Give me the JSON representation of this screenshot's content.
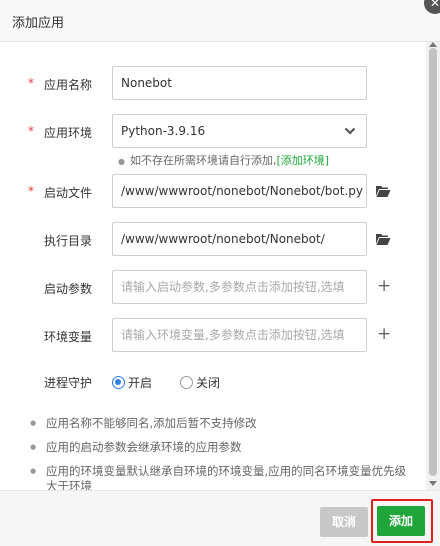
{
  "dialog": {
    "title": "添加应用",
    "close_icon": "close-icon"
  },
  "form": {
    "app_name": {
      "label": "应用名称",
      "required": true,
      "value": "Nonebot"
    },
    "app_env": {
      "label": "应用环境",
      "required": true,
      "value": "Python-3.9.16",
      "hint_text": "如不存在所需环境请自行添加,",
      "hint_link": "[添加环境]"
    },
    "start_file": {
      "label": "启动文件",
      "required": true,
      "value": "/www/wwwroot/nonebot/Nonebot/bot.py"
    },
    "exec_dir": {
      "label": "执行目录",
      "value": "/www/wwwroot/nonebot/Nonebot/"
    },
    "start_params": {
      "label": "启动参数",
      "placeholder": "请输入启动参数,多参数点击添加按钮,选填"
    },
    "env_vars": {
      "label": "环境变量",
      "placeholder": "请输入环境变量,多参数点击添加按钮,选填"
    },
    "daemon": {
      "label": "进程守护",
      "options": [
        {
          "label": "开启",
          "checked": true
        },
        {
          "label": "关闭",
          "checked": false
        }
      ]
    }
  },
  "notes": [
    "应用名称不能够同名,添加后暂不支持修改",
    "应用的启动参数会继承环境的应用参数",
    "应用的环境变量默认继承自环境的环境变量,应用的同名环境变量优先级大于环境"
  ],
  "footer": {
    "cancel_label": "取消",
    "add_label": "添加"
  },
  "colors": {
    "accent": "#20a53a",
    "required": "#e23c3c",
    "link": "#20a53a",
    "radio": "#2f7ee8",
    "highlight_frame": "#e02020"
  }
}
